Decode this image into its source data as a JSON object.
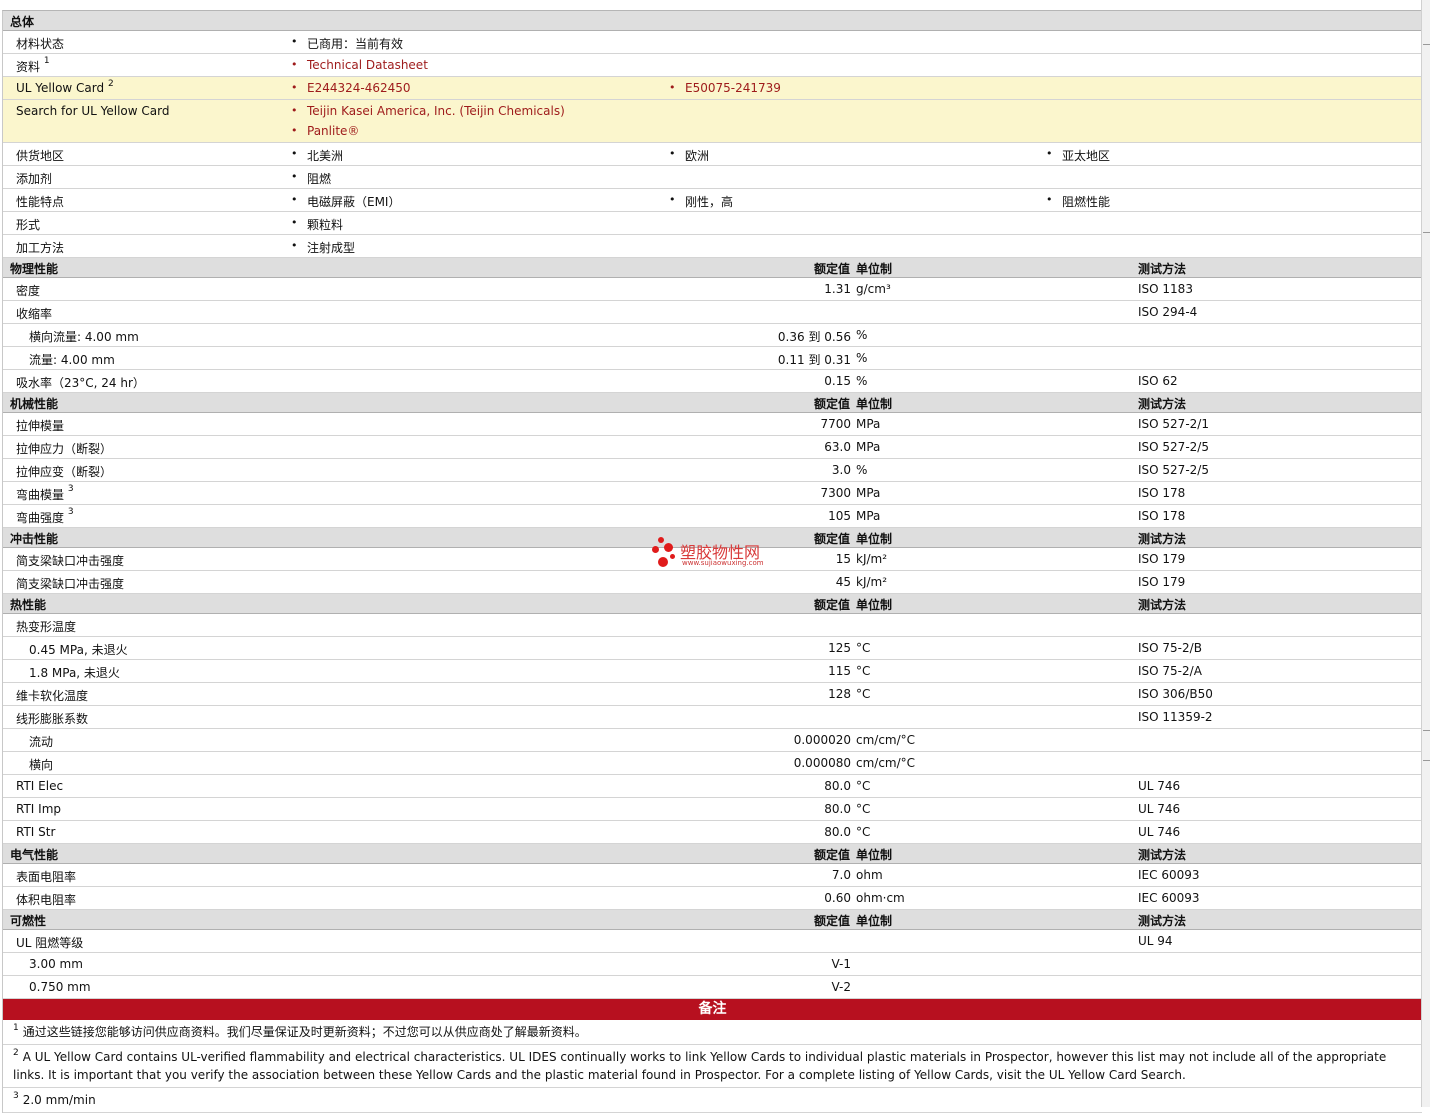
{
  "headers": {
    "value": "额定值",
    "unit": "单位制",
    "method": "测试方法"
  },
  "general": {
    "title": "总体",
    "material_status": {
      "label": "材料状态",
      "value": "已商用：当前有效"
    },
    "documents": {
      "label": "资料",
      "sup": "1",
      "value": "Technical Datasheet"
    },
    "ul_yellow_card": {
      "label": "UL Yellow Card",
      "sup": "2",
      "values": [
        "E244324-462450",
        "E50075-241739"
      ]
    },
    "search_ul": {
      "label": "Search for UL Yellow Card",
      "values": [
        "Teijin Kasei America, Inc. (Teijin Chemicals)",
        "Panlite®"
      ]
    },
    "supply_region": {
      "label": "供货地区",
      "values": [
        "北美洲",
        "欧洲",
        "亚太地区"
      ]
    },
    "additives": {
      "label": "添加剂",
      "values": [
        "阻燃"
      ]
    },
    "features": {
      "label": "性能特点",
      "values": [
        "电磁屏蔽（EMI）",
        "刚性，高",
        "阻燃性能"
      ]
    },
    "form": {
      "label": "形式",
      "values": [
        "颗粒料"
      ]
    },
    "processing": {
      "label": "加工方法",
      "values": [
        "注射成型"
      ]
    }
  },
  "physical": {
    "title": "物理性能",
    "rows": [
      {
        "label": "密度",
        "value": "1.31",
        "unit": "g/cm³",
        "method": "ISO 1183"
      },
      {
        "label": "收缩率",
        "value": "",
        "unit": "",
        "method": "ISO 294-4"
      },
      {
        "label": "横向流量: 4.00 mm",
        "value": "0.36 到  0.56",
        "unit": "%",
        "method": ""
      },
      {
        "label": "流量: 4.00 mm",
        "value": "0.11 到  0.31",
        "unit": "%",
        "method": ""
      },
      {
        "label": "吸水率（23°C, 24 hr）",
        "value": "0.15",
        "unit": "%",
        "method": "ISO 62"
      }
    ]
  },
  "mechanical": {
    "title": "机械性能",
    "rows": [
      {
        "label": "拉伸模量",
        "value": "7700",
        "unit": "MPa",
        "method": "ISO 527-2/1"
      },
      {
        "label": "拉伸应力（断裂）",
        "value": "63.0",
        "unit": "MPa",
        "method": "ISO 527-2/5"
      },
      {
        "label": "拉伸应变（断裂）",
        "value": "3.0",
        "unit": "%",
        "method": "ISO 527-2/5"
      },
      {
        "label": "弯曲模量",
        "sup": "3",
        "value": "7300",
        "unit": "MPa",
        "method": "ISO 178"
      },
      {
        "label": "弯曲强度",
        "sup": "3",
        "value": "105",
        "unit": "MPa",
        "method": "ISO 178"
      }
    ]
  },
  "impact": {
    "title": "冲击性能",
    "rows": [
      {
        "label": "简支梁缺口冲击强度",
        "value": "15",
        "unit": "kJ/m²",
        "method": "ISO 179"
      },
      {
        "label": "简支梁缺口冲击强度",
        "value": "45",
        "unit": "kJ/m²",
        "method": "ISO 179"
      }
    ]
  },
  "thermal": {
    "title": "热性能",
    "rows": [
      {
        "label": "热变形温度",
        "value": "",
        "unit": "",
        "method": ""
      },
      {
        "label": "0.45 MPa, 未退火",
        "value": "125",
        "unit": "°C",
        "method": "ISO 75-2/B"
      },
      {
        "label": "1.8 MPa, 未退火",
        "value": "115",
        "unit": "°C",
        "method": "ISO 75-2/A"
      },
      {
        "label": "维卡软化温度",
        "value": "128",
        "unit": "°C",
        "method": "ISO 306/B50"
      },
      {
        "label": "线形膨胀系数",
        "value": "",
        "unit": "",
        "method": "ISO 11359-2"
      },
      {
        "label": "流动",
        "value": "0.000020",
        "unit": "cm/cm/°C",
        "method": ""
      },
      {
        "label": "横向",
        "value": "0.000080",
        "unit": "cm/cm/°C",
        "method": ""
      },
      {
        "label": "RTI Elec",
        "value": "80.0",
        "unit": "°C",
        "method": "UL 746"
      },
      {
        "label": "RTI Imp",
        "value": "80.0",
        "unit": "°C",
        "method": "UL 746"
      },
      {
        "label": "RTI Str",
        "value": "80.0",
        "unit": "°C",
        "method": "UL 746"
      }
    ]
  },
  "electrical": {
    "title": "电气性能",
    "rows": [
      {
        "label": "表面电阻率",
        "value": "7.0",
        "unit": "ohm",
        "method": "IEC 60093"
      },
      {
        "label": "体积电阻率",
        "value": "0.60",
        "unit": "ohm·cm",
        "method": "IEC 60093"
      }
    ]
  },
  "flammability": {
    "title": "可燃性",
    "rows": [
      {
        "label": "UL 阻燃等级",
        "value": "",
        "unit": "",
        "method": "UL 94"
      },
      {
        "label": "3.00 mm",
        "value": "V-1",
        "unit": "",
        "method": ""
      },
      {
        "label": "0.750 mm",
        "value": "V-2",
        "unit": "",
        "method": ""
      }
    ]
  },
  "notes": {
    "title": "备注",
    "items": [
      {
        "sup": "1",
        "text": "通过这些链接您能够访问供应商资料。我们尽量保证及时更新资料；不过您可以从供应商处了解最新资料。"
      },
      {
        "sup": "2",
        "text": "A UL Yellow Card contains UL-verified flammability and electrical characteristics. UL IDES continually works to link Yellow Cards to individual plastic materials in Prospector, however this list may not include all of the appropriate links. It is important that you verify the association between these Yellow Cards and the plastic material found in Prospector. For a complete listing of Yellow Cards, visit the UL Yellow Card Search."
      },
      {
        "sup": "3",
        "text": "2.0 mm/min"
      }
    ]
  },
  "watermark": {
    "title": "塑胶物性网",
    "url": "www.sujiaowuxing.com"
  },
  "colors": {
    "accent": "#b7101f",
    "link": "#9e1b1b",
    "highlight": "#fbf6cd",
    "section_bg": "#dedede"
  }
}
